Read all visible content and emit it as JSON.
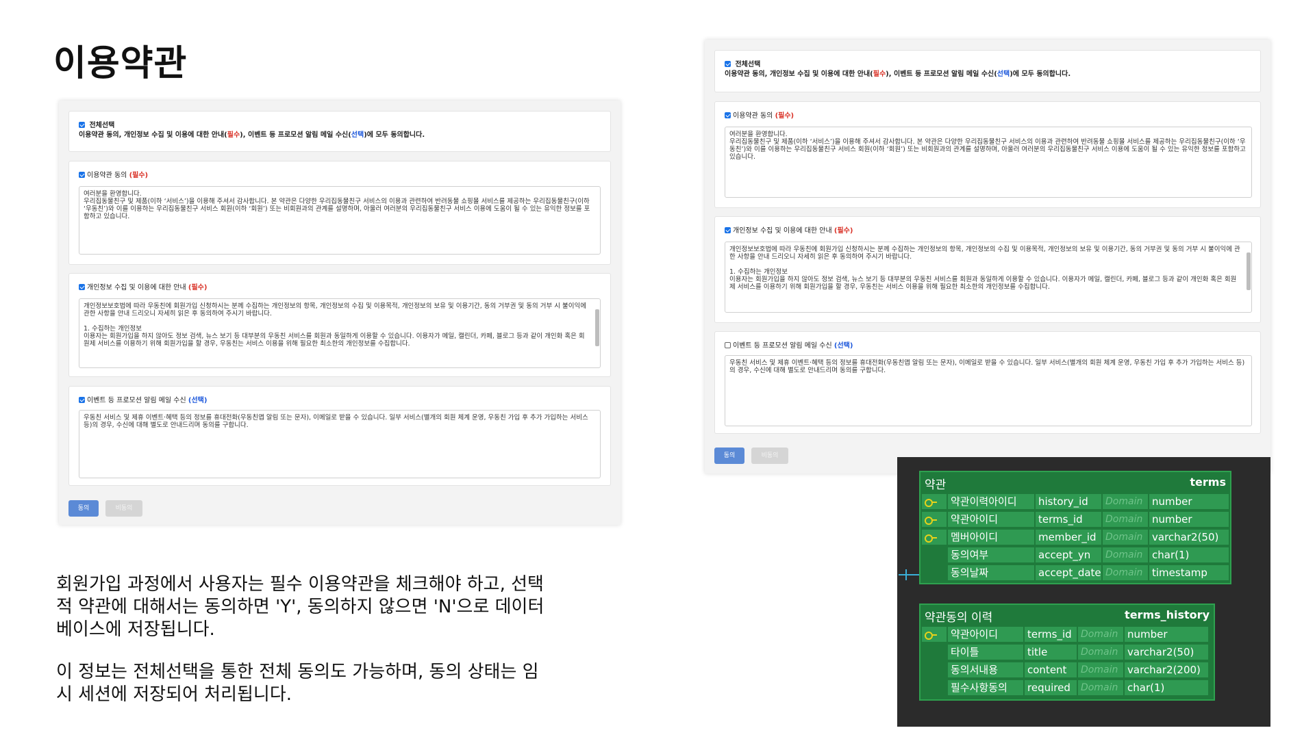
{
  "title": "이용약관",
  "description": {
    "p1": "회원가입 과정에서 사용자는 필수 이용약관을 체크해야 하고, 선택적 약관에 대해서는 동의하면 'Y', 동의하지 않으면 'N'으로 데이터베이스에 저장됩니다.",
    "p2": "이 정보는 전체선택을 통한 전체 동의도 가능하며, 동의 상태는 임시 세션에 저장되어 처리됩니다."
  },
  "form": {
    "select_all_label": "전체선택",
    "select_all_desc_a": "이용약관 동의, 개인정보 수집 및 이용에 대한 안내(",
    "select_all_desc_req": "필수",
    "select_all_desc_b": "), 이벤트 등 프로모션 알림 메일 수신(",
    "select_all_desc_opt": "선택",
    "select_all_desc_c": ")에 모두 동의합니다.",
    "terms_label": "이용약관 동의 ",
    "terms_tag": "(필수)",
    "terms_text": "여러분을 환영합니다.\n우리집동물친구 및 제품(이하 ‘서비스’)을 이용해 주셔서 감사합니다. 본 약관은 다양한 우리집동물친구 서비스의 이용과 관련하여 반려동물 쇼핑몰 서비스를 제공하는 우리집동물친구(이하 ‘우동친’)와 이를 이용하는 우리집동물친구 서비스 회원(이하 ‘회원’) 또는 비회원과의 관계를 설명하며, 아울러 여러분의 우리집동물친구 서비스 이용에 도움이 될 수 있는 유익한 정보를 포함하고 있습니다.",
    "privacy_label": "개인정보 수집 및 이용에 대한 안내 ",
    "privacy_tag": "(필수)",
    "privacy_text": "개인정보보호법에 따라 우동친에 회원가입 신청하시는 분께 수집하는 개인정보의 항목, 개인정보의 수집 및 이용목적, 개인정보의 보유 및 이용기간, 동의 거부권 및 동의 거부 시 불이익에 관한 사항을 안내 드리오니 자세히 읽은 후 동의하여 주시기 바랍니다.\n\n1. 수집하는 개인정보\n이용자는 회원가입을 하지 않아도 정보 검색, 뉴스 보기 등 대부분의 우동친 서비스를 회원과 동일하게 이용할 수 있습니다. 이용자가 메일, 캘린더, 카페, 블로그 등과 같이 개인화 혹은 회원제 서비스를 이용하기 위해 회원가입을 할 경우, 우동친는 서비스 이용을 위해 필요한 최소한의 개인정보를 수집합니다.",
    "event_label": "이벤트 등 프로모션 알림 메일 수신 ",
    "event_tag": "(선택)",
    "event_text": "우동친 서비스 및 제휴 이벤트·혜택 등의 정보를 휴대전화(우동친앱 알림 또는 문자), 이메일로 받을 수 있습니다. 일부 서비스(별개의 회원 체계 운영, 우동친 가입 후 추가 가입하는 서비스 등)의 경우, 수신에 대해 별도로 안내드리며 동의를 구합니다.",
    "agree_button": "동의",
    "disagree_button": "비동의"
  },
  "erd": {
    "terms": {
      "ko": "약관",
      "en": "terms",
      "rows": [
        {
          "ko": "약관이력아이디",
          "col": "history_id",
          "domain": "Domain",
          "type": "number",
          "key": true
        },
        {
          "ko": "약관아이디",
          "col": "terms_id",
          "domain": "Domain",
          "type": "number",
          "key": true
        },
        {
          "ko": "멤버아이디",
          "col": "member_id",
          "domain": "Domain",
          "type": "varchar2(50)",
          "key": true
        },
        {
          "ko": "동의여부",
          "col": "accept_yn",
          "domain": "Domain",
          "type": "char(1)",
          "key": false
        },
        {
          "ko": "동의날짜",
          "col": "accept_date",
          "domain": "Domain",
          "type": "timestamp",
          "key": false
        }
      ]
    },
    "terms_history": {
      "ko": "약관동의 이력",
      "en": "terms_history",
      "rows": [
        {
          "ko": "약관아이디",
          "col": "terms_id",
          "domain": "Domain",
          "type": "number",
          "key": true
        },
        {
          "ko": "타이틀",
          "col": "title",
          "domain": "Domain",
          "type": "varchar2(50)",
          "key": false
        },
        {
          "ko": "동의서내용",
          "col": "content",
          "domain": "Domain",
          "type": "varchar2(200)",
          "key": false
        },
        {
          "ko": "필수사항동의",
          "col": "required",
          "domain": "Domain",
          "type": "char(1)",
          "key": false
        }
      ]
    }
  },
  "colors": {
    "required": "#d93025",
    "optional": "#1a56db",
    "agree_button": "#5b8ad6",
    "entity_bg": "#1f7a3b"
  }
}
